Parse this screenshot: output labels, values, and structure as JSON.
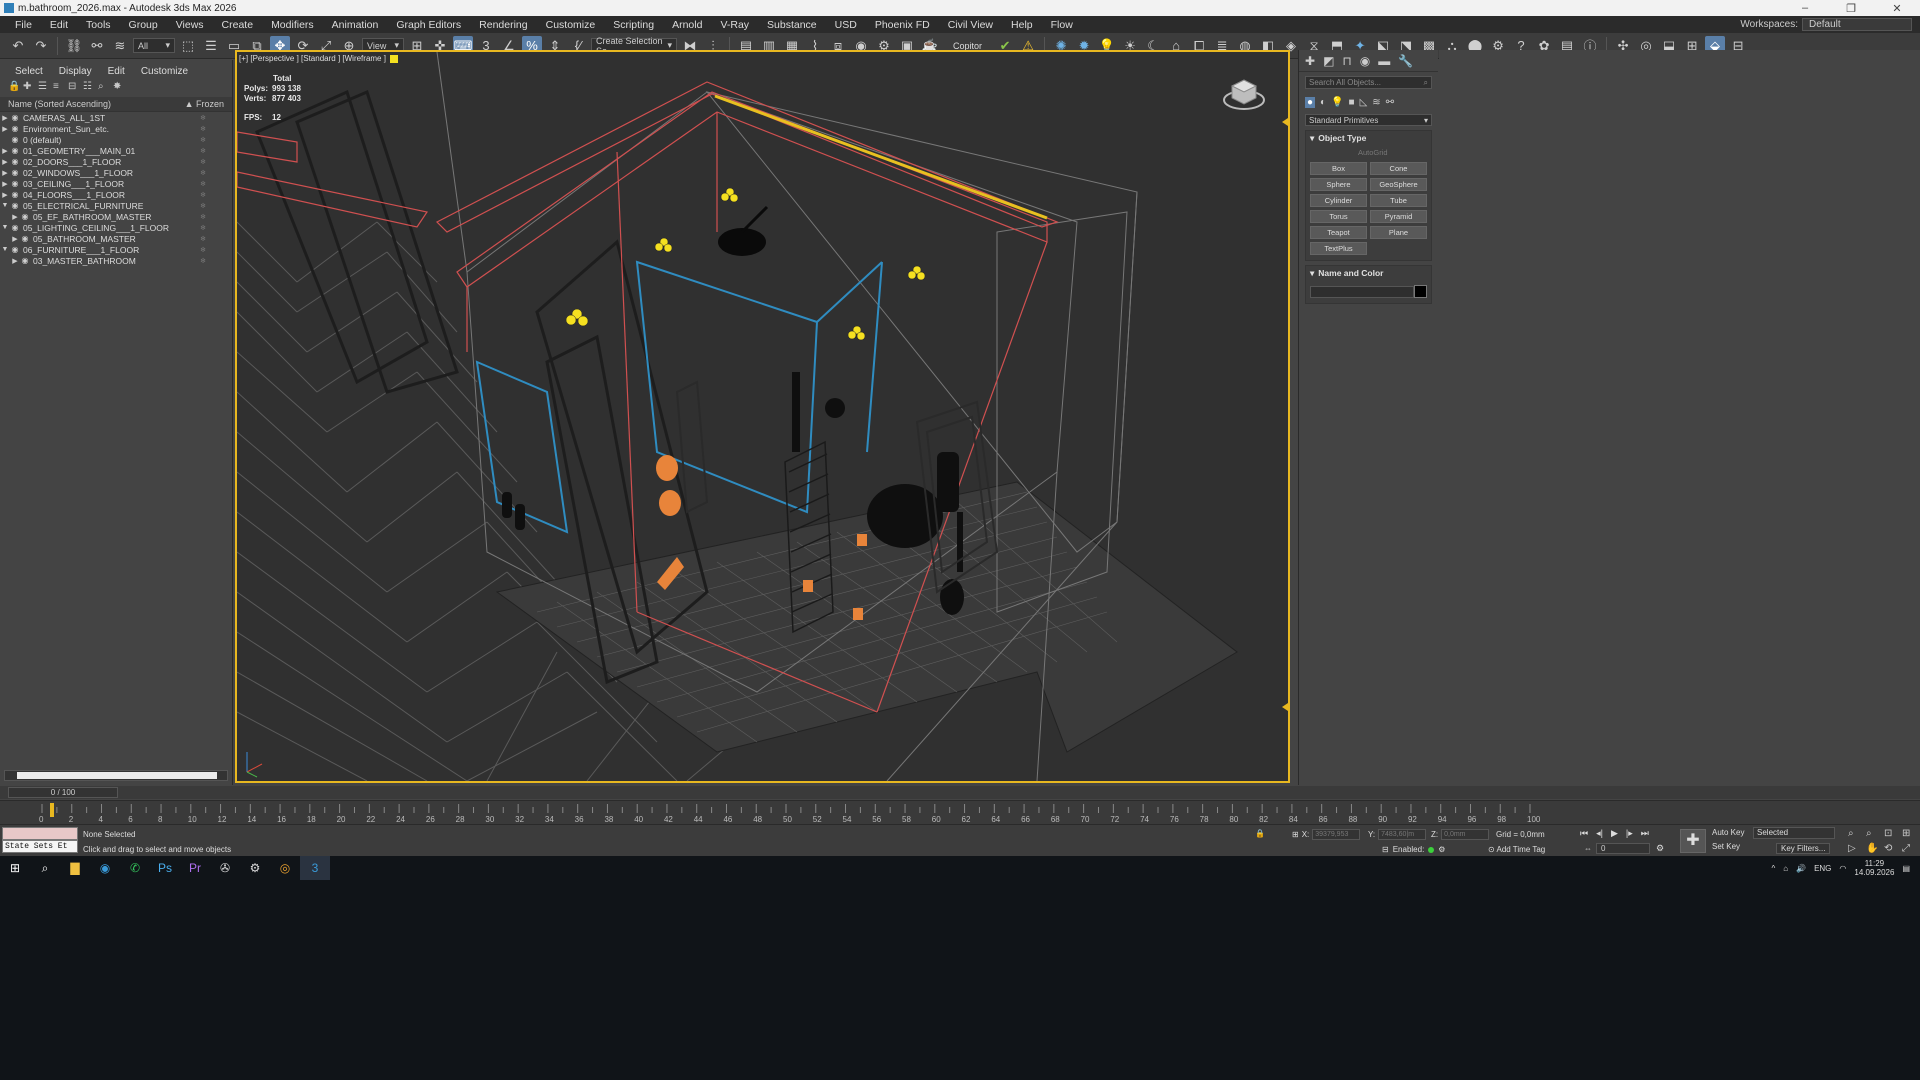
{
  "window": {
    "title": "m.bathroom_2026.max - Autodesk 3ds Max 2026"
  },
  "menu": {
    "items": [
      "File",
      "Edit",
      "Tools",
      "Group",
      "Views",
      "Create",
      "Modifiers",
      "Animation",
      "Graph Editors",
      "Rendering",
      "Customize",
      "Scripting",
      "Arnold",
      "V-Ray",
      "Substance",
      "USD",
      "Phoenix FD",
      "Civil View",
      "Help",
      "Flow"
    ],
    "workspaces_label": "Workspaces:",
    "workspace_value": "Default"
  },
  "toolbar": {
    "selection_filter": "All",
    "ref_coord": "View",
    "named_selection": "Create Selection Se",
    "copitor": "Copitor"
  },
  "explorer": {
    "tabs": [
      "Select",
      "Display",
      "Edit",
      "Customize"
    ],
    "sort_label": "Name (Sorted Ascending)",
    "frozen_label": "▲ Frozen",
    "layers": [
      {
        "name": "CAMERAS_ALL_1ST",
        "indent": 0,
        "arrow": "▶",
        "prefix": "•"
      },
      {
        "name": "Environment_Sun_etc.",
        "indent": 0,
        "arrow": "▶",
        "prefix": "•"
      },
      {
        "name": "0 (default)",
        "indent": 0,
        "arrow": "",
        "prefix": ""
      },
      {
        "name": "01_GEOMETRY___MAIN_01",
        "indent": 0,
        "arrow": "▶",
        "prefix": ""
      },
      {
        "name": "02_DOORS___1_FLOOR",
        "indent": 0,
        "arrow": "▶",
        "prefix": ""
      },
      {
        "name": "02_WINDOWS___1_FLOOR",
        "indent": 0,
        "arrow": "▶",
        "prefix": ""
      },
      {
        "name": "03_CEILING___1_FLOOR",
        "indent": 0,
        "arrow": "▶",
        "prefix": ""
      },
      {
        "name": "04_FLOORS___1_FLOOR",
        "indent": 0,
        "arrow": "▶",
        "prefix": ""
      },
      {
        "name": "05_ELECTRICAL_FURNITURE",
        "indent": 0,
        "arrow": "▼",
        "prefix": ""
      },
      {
        "name": "05_EF_BATHROOM_MASTER",
        "indent": 1,
        "arrow": "▶",
        "prefix": ""
      },
      {
        "name": "05_LIGHTING_CEILING___1_FLOOR",
        "indent": 0,
        "arrow": "▼",
        "prefix": ""
      },
      {
        "name": "05_BATHROOM_MASTER",
        "indent": 1,
        "arrow": "▶",
        "prefix": ""
      },
      {
        "name": "06_FURNITURE___1_FLOOR",
        "indent": 0,
        "arrow": "▼",
        "prefix": ""
      },
      {
        "name": "03_MASTER_BATHROOM",
        "indent": 1,
        "arrow": "▶",
        "prefix": "•"
      }
    ]
  },
  "viewport": {
    "label": "[+] [Perspective ] [Standard ] [Wireframe ]",
    "stats_total": "Total",
    "polys_label": "Polys:",
    "polys_value": "993 138",
    "verts_label": "Verts:",
    "verts_value": "877 403",
    "fps_label": "FPS:",
    "fps_value": "12"
  },
  "command_panel": {
    "search_placeholder": "Search All Objects...",
    "category": "Standard Primitives",
    "object_type_title": "Object Type",
    "autogrid": "AutoGrid",
    "buttons": [
      "Box",
      "Cone",
      "Sphere",
      "GeoSphere",
      "Cylinder",
      "Tube",
      "Torus",
      "Pyramid",
      "Teapot",
      "Plane",
      "TextPlus"
    ],
    "name_color_title": "Name and Color"
  },
  "timeline": {
    "frame_display": "0 / 100",
    "ticks": [
      "0",
      "2",
      "4",
      "6",
      "8",
      "10",
      "12",
      "14",
      "16",
      "18",
      "20",
      "22",
      "24",
      "26",
      "28",
      "30",
      "32",
      "34",
      "36",
      "38",
      "40",
      "42",
      "44",
      "46",
      "48",
      "50",
      "52",
      "54",
      "56",
      "58",
      "60",
      "62",
      "64",
      "66",
      "68",
      "70",
      "72",
      "74",
      "76",
      "78",
      "80",
      "82",
      "84",
      "86",
      "88",
      "90",
      "92",
      "94",
      "96",
      "98",
      "100"
    ]
  },
  "status": {
    "maxscript_label": "State Sets Et",
    "selection": "None Selected",
    "prompt": "Click and drag to select and move objects",
    "x_label": "X:",
    "x_value": "39379,953",
    "y_label": "Y:",
    "y_value": "7483,60|m",
    "z_label": "Z:",
    "z_value": "0,0mm",
    "grid": "Grid = 0,0mm",
    "enabled_label": "Enabled:",
    "add_time_tag": "Add Time Tag",
    "frame_value": "0",
    "auto_key": "Auto Key",
    "set_key": "Set Key",
    "selected_dropdown": "Selected",
    "key_filters": "Key Filters..."
  },
  "taskbar": {
    "lang": "ENG",
    "time": "11:29",
    "date": "14.09.2026"
  }
}
